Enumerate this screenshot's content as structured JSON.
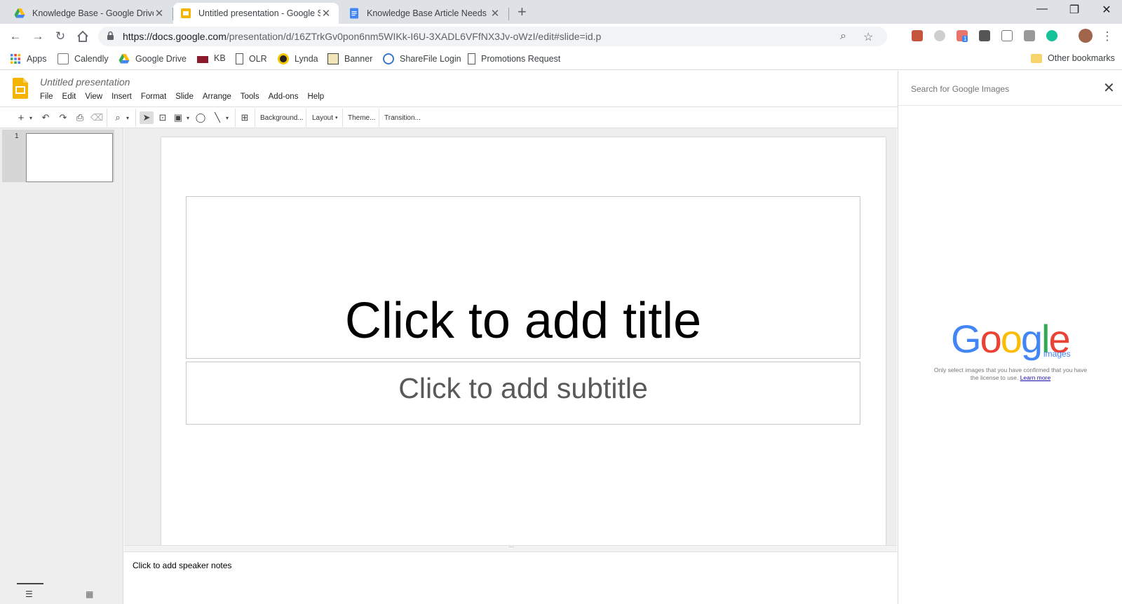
{
  "browser": {
    "tabs": [
      {
        "title": "Knowledge Base - Google Drive",
        "icon": "google-drive-icon"
      },
      {
        "title": "Untitled presentation - Google S",
        "icon": "google-slides-icon",
        "active": true
      },
      {
        "title": "Knowledge Base Article Needs -",
        "icon": "google-docs-icon"
      }
    ],
    "url_host": "https://docs.google.com",
    "url_path": "/presentation/d/16ZTrkGv0pon6nm5WIKk-I6U-3XADL6VFfNX3Jv-oWzI/edit#slide=id.p",
    "bookmarks": [
      {
        "label": "Apps",
        "icon": "apps-grid-icon"
      },
      {
        "label": "Calendly",
        "icon": "page-icon"
      },
      {
        "label": "Google Drive",
        "icon": "google-drive-icon"
      },
      {
        "label": "KB",
        "icon": "kb-icon"
      },
      {
        "label": "OLR",
        "icon": "page-icon"
      },
      {
        "label": "Lynda",
        "icon": "lynda-icon"
      },
      {
        "label": "Banner",
        "icon": "banner-icon"
      },
      {
        "label": "ShareFile Login",
        "icon": "sharefile-icon"
      },
      {
        "label": "Promotions Request",
        "icon": "page-icon"
      }
    ],
    "other_bookmarks": "Other bookmarks",
    "extension_badge": "1"
  },
  "slides": {
    "doc_title": "Untitled presentation",
    "menu": [
      "File",
      "Edit",
      "View",
      "Insert",
      "Format",
      "Slide",
      "Arrange",
      "Tools",
      "Add-ons",
      "Help"
    ],
    "toolbar": {
      "background": "Background...",
      "layout": "Layout",
      "theme": "Theme...",
      "transition": "Transition..."
    },
    "slide_number": "1",
    "title_placeholder": "Click to add title",
    "subtitle_placeholder": "Click to add subtitle",
    "notes_placeholder": "Click to add speaker notes"
  },
  "side_panel": {
    "search_placeholder": "Search for Google Images",
    "logo_sub": "images",
    "license_note": "Only select images that you have confirmed that you have the license to use.",
    "learn_more": "Learn more"
  },
  "colors": {
    "google_blue": "#4285f4",
    "google_red": "#ea4335",
    "google_yellow": "#fbbc05",
    "google_green": "#34a853",
    "slides_yellow": "#f4b400"
  }
}
